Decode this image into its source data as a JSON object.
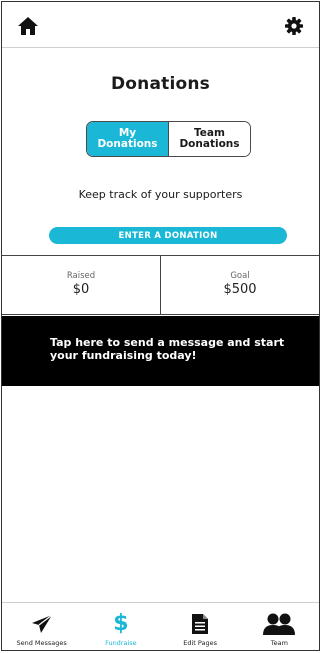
{
  "header": {
    "home_icon": "home-icon",
    "settings_icon": "gear-icon"
  },
  "page": {
    "title": "Donations",
    "subtitle": "Keep track of your supporters"
  },
  "segments": {
    "my_line1": "My",
    "my_line2": "Donations",
    "team_line1": "Team",
    "team_line2": "Donations",
    "active": "my"
  },
  "cta": {
    "label": "ENTER A DONATION"
  },
  "stats": {
    "raised_label": "Raised",
    "raised_value": "$0",
    "goal_label": "Goal",
    "goal_value": "$500"
  },
  "banner": {
    "text": "Tap here to send a message and start your fundraising today!"
  },
  "tabs": [
    {
      "label": "Send Messages",
      "icon": "paper-plane-icon"
    },
    {
      "label": "Fundraise",
      "icon": "dollar-icon",
      "active": true
    },
    {
      "label": "Edit Pages",
      "icon": "document-icon"
    },
    {
      "label": "Team",
      "icon": "team-icon"
    }
  ],
  "colors": {
    "accent": "#1ab8d6",
    "banner": "#000000"
  }
}
